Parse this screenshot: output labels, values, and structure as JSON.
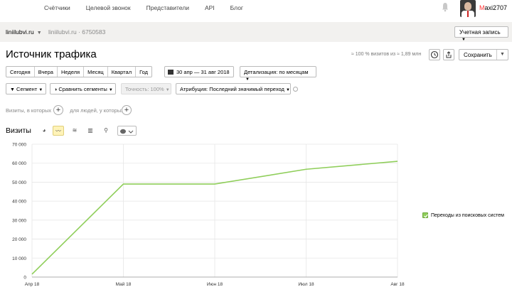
{
  "topnav": {
    "links": [
      "Счётчики",
      "Целевой звонок",
      "Представители",
      "API",
      "Блог"
    ],
    "user": {
      "first": "M",
      "rest": "axi2707"
    }
  },
  "subbar": {
    "site": "liniilubvi.ru",
    "crumb": "liniilubvi.ru · 6750583",
    "account_label": "Учетная запись"
  },
  "header": {
    "title": "Источник трафика",
    "visits_info": "≈ 100 % визитов из ≈ 1,89 млн",
    "save_label": "Сохранить"
  },
  "periods": [
    "Сегодня",
    "Вчера",
    "Неделя",
    "Месяц",
    "Квартал",
    "Год"
  ],
  "date_range": "30 апр — 31 авг 2018",
  "detail_label": "Детализация: по месяцам",
  "filters": {
    "segment": "Сегмент",
    "compare": "Сравнить сегменты",
    "accuracy": "Точность: 100%",
    "attribution": "Атрибуция: Последний значимый переход"
  },
  "segment_row": {
    "visits_which": "Визиты, в которых",
    "for_people": "для людей, у которых"
  },
  "chart_section": {
    "label": "Визиты"
  },
  "colors": {
    "line": "#8fce5a",
    "accent_active": "#fff3b8"
  },
  "chart_data": {
    "type": "line",
    "x": [
      "Апр 18",
      "Май 18",
      "Июн 18",
      "Июл 18",
      "Авг 18"
    ],
    "yticks": [
      "70 000",
      "60 000",
      "50 000",
      "40 000",
      "30 000",
      "20 000",
      "10 000",
      "0"
    ],
    "ylim": [
      0,
      70000
    ],
    "series": [
      {
        "name": "Переходы из поисковых систем",
        "values": [
          1500,
          49000,
          49000,
          56800,
          61000
        ]
      }
    ],
    "grid": true,
    "legend": "right"
  }
}
